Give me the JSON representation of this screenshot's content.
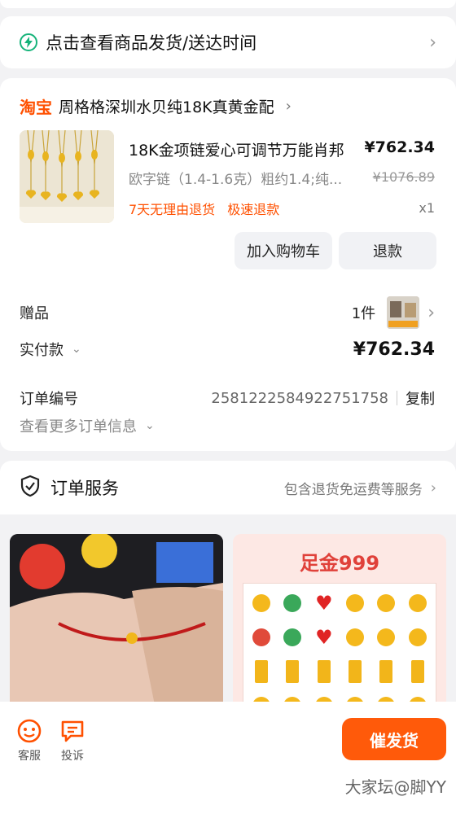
{
  "shipping": {
    "label": "点击查看商品发货/送达时间"
  },
  "shop": {
    "platform": "淘宝",
    "name": "周格格深圳水贝纯18K真黄金配"
  },
  "product": {
    "title": "18K金项链爱心可调节万能肖邦",
    "price": "¥762.34",
    "spec": "欧字链（1.4-1.6克）粗约1.4;纯...",
    "original_price": "¥1076.89",
    "tags": [
      "7天无理由退货",
      "极速退款"
    ],
    "quantity": "x1"
  },
  "actions": {
    "add_to_cart": "加入购物车",
    "refund": "退款"
  },
  "gift": {
    "label": "赠品",
    "count": "1件"
  },
  "payment": {
    "label": "实付款",
    "amount": "¥762.34"
  },
  "order": {
    "number_label": "订单编号",
    "number": "2581222584922751758",
    "copy": "复制",
    "more": "查看更多订单信息"
  },
  "service": {
    "title": "订单服务",
    "desc": "包含退货免运费等服务"
  },
  "recommend": {
    "right_title": "足金999"
  },
  "bottom": {
    "kefu": "客服",
    "complain": "投诉",
    "urge": "催发货"
  },
  "watermark": "大家坛@脚YY",
  "colors": {
    "accent": "#ff5000",
    "ship_icon": "#16b37a"
  }
}
